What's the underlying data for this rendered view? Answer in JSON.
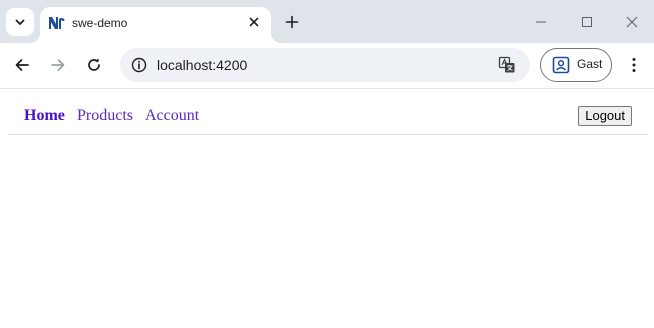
{
  "browser": {
    "tab": {
      "title": "swe-demo",
      "favicon": "ngrx-logo-icon"
    },
    "new_tab_label": "+",
    "toolbar": {
      "url": "localhost:4200",
      "profile_label": "Gast"
    }
  },
  "app": {
    "nav": {
      "links": [
        {
          "label": "Home",
          "active": true
        },
        {
          "label": "Products",
          "active": false
        },
        {
          "label": "Account",
          "active": false
        }
      ],
      "logout_label": "Logout"
    }
  },
  "colors": {
    "tabstrip_bg": "#dfe3ea",
    "omnibox_bg": "#eef1f6",
    "link": "#5a2bb8",
    "link_active": "#4b10c8",
    "favicon_blue": "#1a4b9e"
  }
}
